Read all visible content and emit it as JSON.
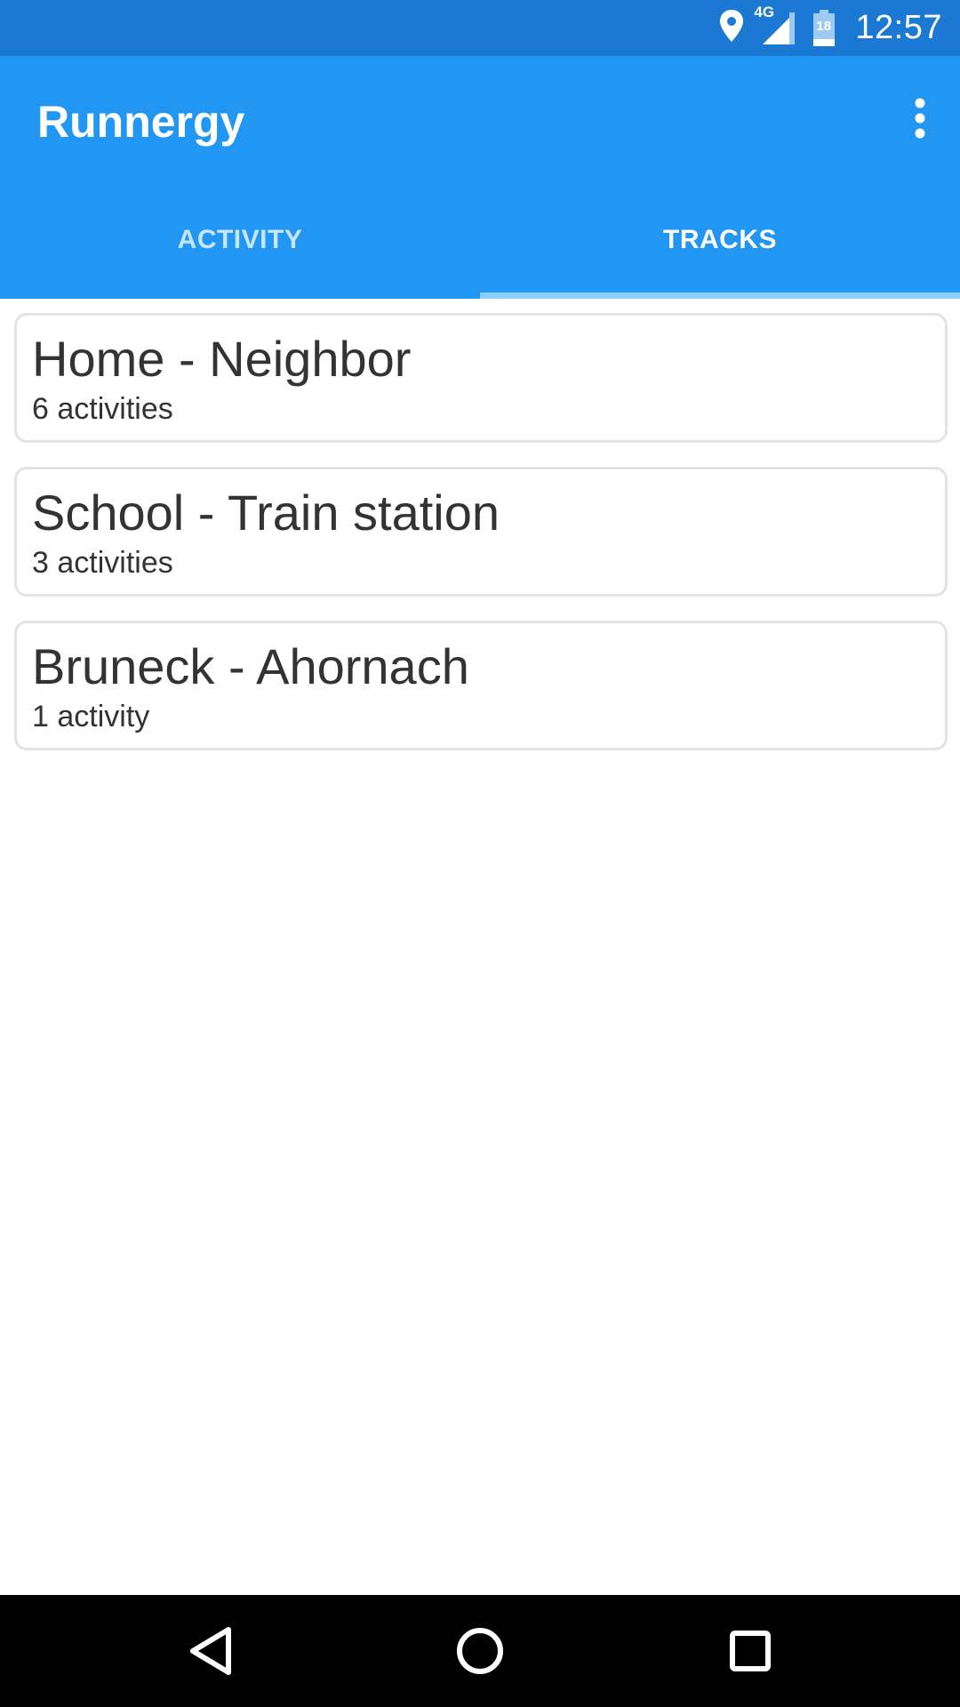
{
  "status_bar": {
    "time": "12:57",
    "network_label": "4G",
    "battery_level": "18",
    "icons": [
      "location-icon",
      "signal-icon",
      "battery-icon"
    ]
  },
  "app_bar": {
    "title": "Runnergy",
    "menu_icon": "more-vert-icon"
  },
  "tabs": [
    {
      "label": "ACTIVITY",
      "selected": false
    },
    {
      "label": "TRACKS",
      "selected": true
    }
  ],
  "tracks": [
    {
      "name": "Home - Neighbor",
      "count": "6 activities"
    },
    {
      "name": "School - Train station",
      "count": "3 activities"
    },
    {
      "name": "Bruneck - Ahornach",
      "count": "1 activity"
    }
  ],
  "nav_bar": {
    "icons": [
      "back-icon",
      "home-icon",
      "recents-icon"
    ]
  },
  "colors": {
    "status_bar": "#1b79d3",
    "app_bar": "#2196f3",
    "tab_indicator": "#8ccdf9",
    "card_border": "#e3e3e3",
    "text": "#333333"
  }
}
